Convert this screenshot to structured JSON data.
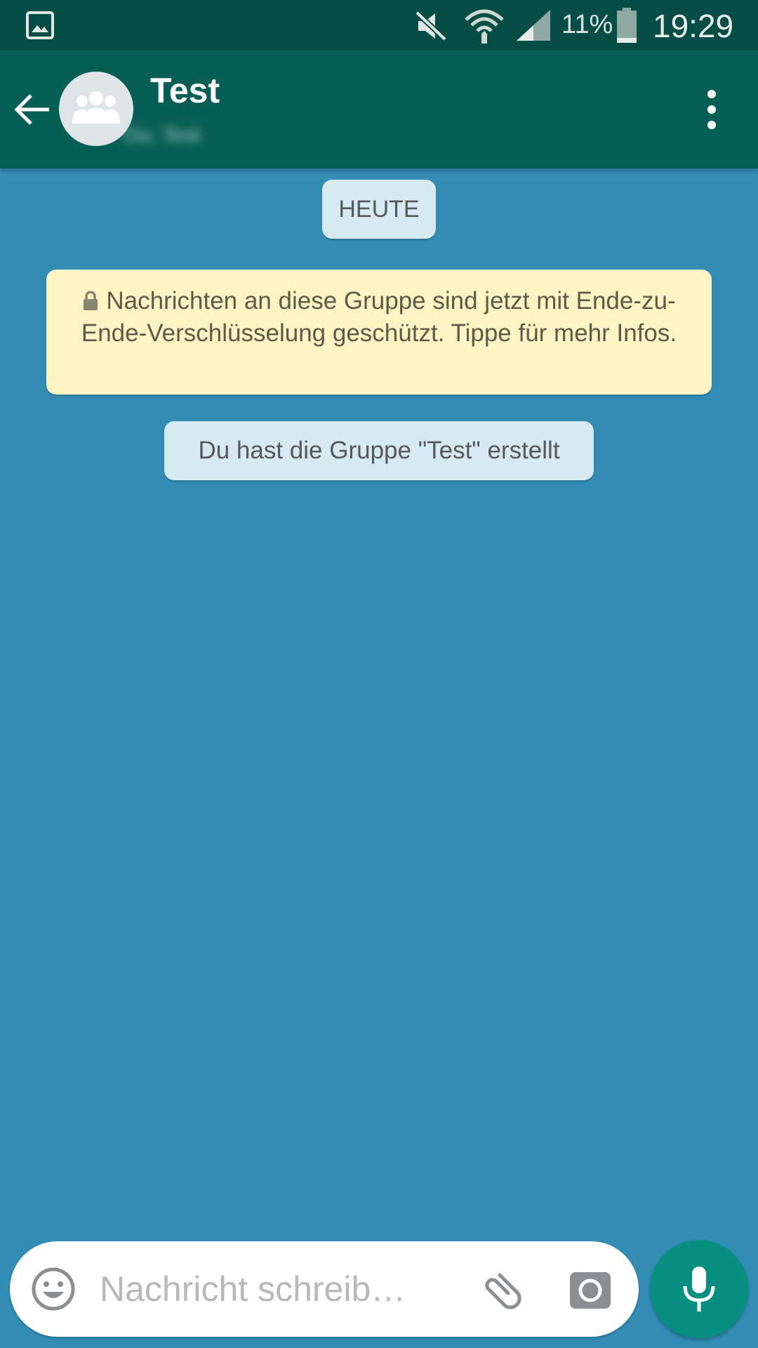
{
  "status_bar": {
    "battery_percent": "11%",
    "time": "19:29",
    "icons": [
      "gallery-icon",
      "mute-icon",
      "wifi-icon",
      "signal-icon",
      "battery-icon"
    ]
  },
  "toolbar": {
    "title": "Test",
    "subtitle_blurred": "Du, Test",
    "icons": [
      "back-arrow-icon",
      "group-avatar-icon",
      "more-vert-icon"
    ]
  },
  "chat": {
    "date_label": "HEUTE",
    "encryption_notice": "Nachrichten an diese Gruppe sind jetzt mit Ende-zu-Ende-Verschlüsselung geschützt. Tippe für mehr Infos.",
    "system_message": "Du hast die Gruppe \"Test\" erstellt"
  },
  "input_bar": {
    "placeholder": "Nachricht schreib…",
    "value": "",
    "icons": [
      "emoji-icon",
      "paperclip-icon",
      "camera-icon",
      "mic-icon"
    ]
  },
  "colors": {
    "status_bar": "#064d45",
    "toolbar": "#075e54",
    "chat_background": "#328cb4",
    "date_chip": "#d7e9f1",
    "notice": "#fdf4c4",
    "mic_button": "#078f80"
  }
}
